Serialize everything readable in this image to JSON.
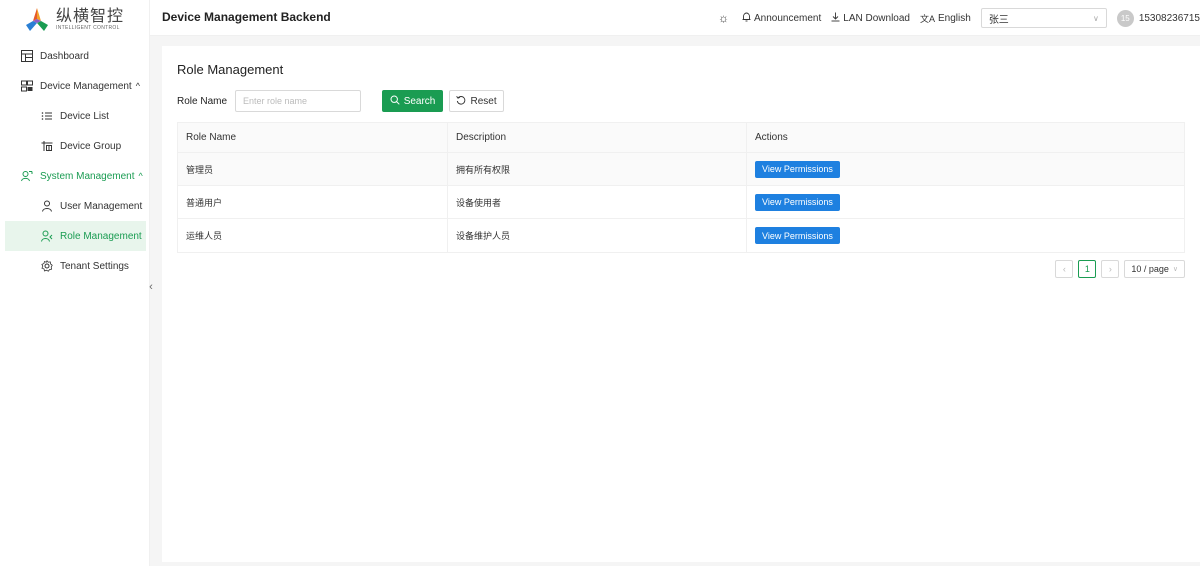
{
  "logo": {
    "cn": "纵横智控",
    "en": "INTELLIGENT CONTROL"
  },
  "sidebar": {
    "items": [
      {
        "label": "Dashboard",
        "icon": "dashboard-icon"
      },
      {
        "label": "Device Management",
        "icon": "device-management-icon",
        "expanded": true
      },
      {
        "label": "Device List",
        "icon": "list-icon"
      },
      {
        "label": "Device Group",
        "icon": "group-icon"
      },
      {
        "label": "System Management",
        "icon": "users-icon",
        "expanded": true
      },
      {
        "label": "User Management",
        "icon": "user-icon"
      },
      {
        "label": "Role Management",
        "icon": "role-icon",
        "active": true
      },
      {
        "label": "Tenant Settings",
        "icon": "gear-icon"
      }
    ],
    "collapse_glyph": "‹"
  },
  "header": {
    "title": "Device Management Backend",
    "announcement": "Announcement",
    "lan_download": "LAN Download",
    "language": "English",
    "user_select": "张三",
    "avatar": "15",
    "phone": "15308236715"
  },
  "main": {
    "title": "Role Management",
    "filter": {
      "label": "Role Name",
      "placeholder": "Enter role name",
      "search": "Search",
      "reset": "Reset"
    },
    "table": {
      "columns": [
        "Role Name",
        "Description",
        "Actions"
      ],
      "rows": [
        {
          "name": "管理员",
          "description": "拥有所有权限",
          "action": "View Permissions"
        },
        {
          "name": "普通用户",
          "description": "设备使用者",
          "action": "View Permissions"
        },
        {
          "name": "运维人员",
          "description": "设备维护人员",
          "action": "View Permissions"
        }
      ]
    },
    "pagination": {
      "current": "1",
      "page_size": "10 / page"
    }
  },
  "colors": {
    "accent": "#1a9c52",
    "link_button": "#1e80e0"
  }
}
